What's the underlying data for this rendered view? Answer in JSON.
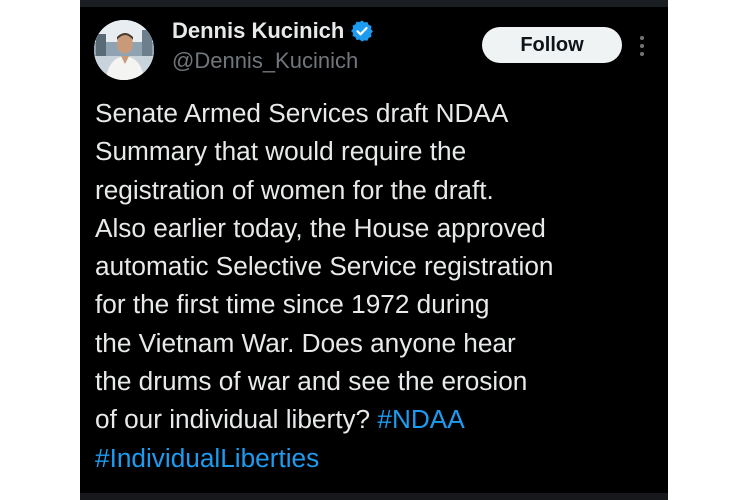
{
  "user": {
    "display_name": "Dennis Kucinich",
    "handle": "@Dennis_Kucinich",
    "verified": true,
    "verified_color": "#1d9bf0"
  },
  "actions": {
    "follow_label": "Follow",
    "more_icon": "more-vertical-icon"
  },
  "tweet": {
    "lines": [
      "Senate Armed Services draft NDAA",
      "Summary that would require the",
      "registration of women for the draft.",
      "Also earlier today, the House approved",
      "automatic Selective Service registration",
      "for the first time since 1972 during",
      "the Vietnam War.  Does anyone hear",
      "the drums of war and see the erosion",
      "of our individual liberty? "
    ],
    "hashtags": [
      "#NDAA",
      "#IndividualLiberties"
    ],
    "hashtag_color": "#1d9bf0"
  },
  "theme": {
    "background": "#000000",
    "text": "#e7e9ea",
    "muted": "#71767b"
  }
}
